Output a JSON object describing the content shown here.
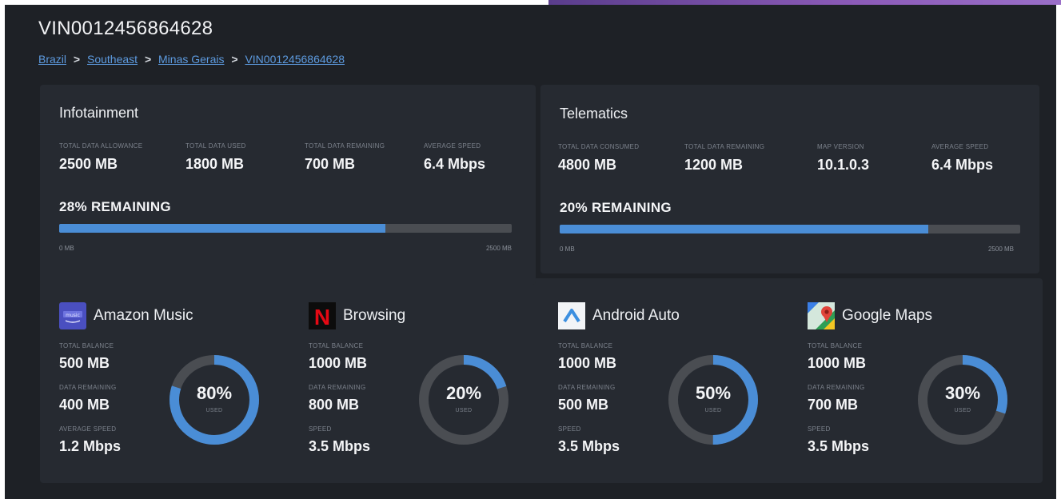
{
  "title": "VIN0012456864628",
  "breadcrumb": [
    {
      "label": "Brazil"
    },
    {
      "label": "Southeast"
    },
    {
      "label": "Minas Gerais"
    },
    {
      "label": "VIN0012456864628"
    }
  ],
  "breadcrumb_separator": ">",
  "infotainment": {
    "title": "Infotainment",
    "stats": [
      {
        "label": "TOTAL DATA ALLOWANCE",
        "value": "2500 MB"
      },
      {
        "label": "TOTAL DATA USED",
        "value": "1800 MB"
      },
      {
        "label": "TOTAL DATA REMAINING",
        "value": "700 MB"
      },
      {
        "label": "AVERAGE SPEED",
        "value": "6.4 Mbps"
      }
    ],
    "remaining_text": "28% REMAINING",
    "used_fraction": 0.72,
    "min_label": "0 MB",
    "max_label": "2500 MB"
  },
  "telematics": {
    "title": "Telematics",
    "stats": [
      {
        "label": "TOTAL DATA CONSUMED",
        "value": "4800 MB"
      },
      {
        "label": "TOTAL DATA REMAINING",
        "value": "1200 MB"
      },
      {
        "label": "MAP VERSION",
        "value": "10.1.0.3"
      },
      {
        "label": "AVERAGE SPEED",
        "value": "6.4 Mbps"
      }
    ],
    "remaining_text": "20% REMAINING",
    "used_fraction": 0.8,
    "min_label": "0 MB",
    "max_label": "2500 MB"
  },
  "apps": [
    {
      "name": "Amazon Music",
      "icon": "amazon-music-icon",
      "stats": [
        {
          "label": "TOTAL BALANCE",
          "value": "500 MB"
        },
        {
          "label": "DATA REMAINING",
          "value": "400 MB"
        },
        {
          "label": "AVERAGE SPEED",
          "value": "1.2 Mbps"
        }
      ],
      "used_percent": "80%",
      "used_fraction": 0.8,
      "used_label": "USED"
    },
    {
      "name": "Browsing",
      "icon": "netflix-icon",
      "stats": [
        {
          "label": "TOTAL BALANCE",
          "value": "1000 MB"
        },
        {
          "label": "DATA REMAINING",
          "value": "800 MB"
        },
        {
          "label": "SPEED",
          "value": "3.5 Mbps"
        }
      ],
      "used_percent": "20%",
      "used_fraction": 0.2,
      "used_label": "USED"
    },
    {
      "name": "Android Auto",
      "icon": "android-auto-icon",
      "stats": [
        {
          "label": "TOTAL BALANCE",
          "value": "1000 MB"
        },
        {
          "label": "DATA REMAINING",
          "value": "500 MB"
        },
        {
          "label": "SPEED",
          "value": "3.5 Mbps"
        }
      ],
      "used_percent": "50%",
      "used_fraction": 0.5,
      "used_label": "USED"
    },
    {
      "name": "Google Maps",
      "icon": "google-maps-icon",
      "stats": [
        {
          "label": "TOTAL BALANCE",
          "value": "1000 MB"
        },
        {
          "label": "DATA REMAINING",
          "value": "700 MB"
        },
        {
          "label": "SPEED",
          "value": "3.5 Mbps"
        }
      ],
      "used_percent": "30%",
      "used_fraction": 0.3,
      "used_label": "USED"
    }
  ],
  "colors": {
    "background": "#1e2126",
    "panel": "#262a31",
    "accent": "#4a8dd6",
    "track": "#4a4d52",
    "link": "#5d9be0"
  },
  "netflix_glyph": "N"
}
